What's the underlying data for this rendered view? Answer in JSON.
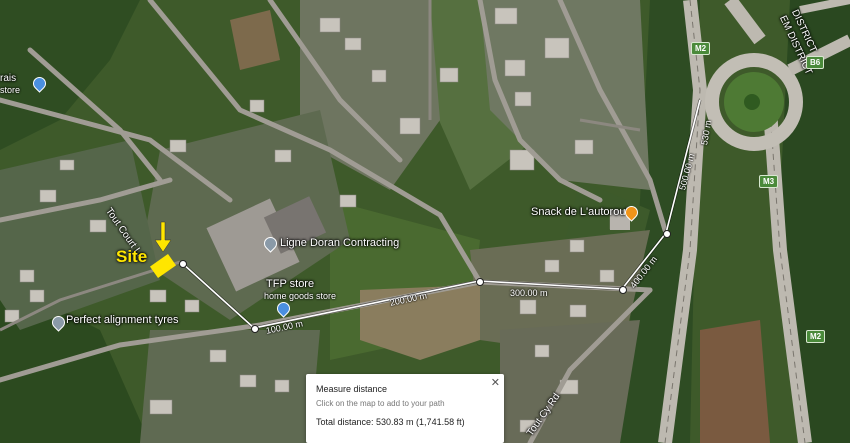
{
  "map": {
    "labels": {
      "tout_court_ln": "Tout Court Ln",
      "site": "Site",
      "ligne_doran": "Ligne Doran Contracting",
      "tfp_store": "TFP store",
      "tfp_sub": "home goods store",
      "perfect_alignment": "Perfect alignment tyres",
      "snack": "Snack de L'autoroute",
      "tout_cy_rd": "Tout Cy Rd",
      "district": "DISTRICT",
      "district2": "EM DISTRICT",
      "rais": "rais",
      "store_left": "store"
    },
    "route_shields": {
      "m2_top": "M2",
      "b6": "B6",
      "m3": "M3",
      "m2_bottom": "M2"
    },
    "measure_labels": {
      "m100": "100.00 m",
      "m200": "200.00 m",
      "m300": "300.00 m",
      "m400": "400.00 m",
      "m500": "500.00 m",
      "m530": "530 m"
    }
  },
  "panel": {
    "title": "Measure distance",
    "hint": "Click on the map to add to your path",
    "total": "Total distance: 530.83 m (1,741.58 ft)",
    "close": "✕"
  }
}
